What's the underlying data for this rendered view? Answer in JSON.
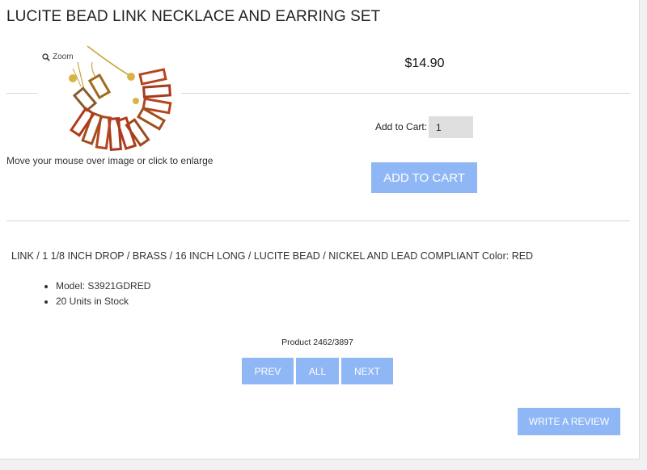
{
  "product": {
    "title": "LUCITE BEAD LINK NECKLACE AND EARRING SET",
    "price": "$14.90",
    "image_alt": "Lucite bead link necklace and earring set"
  },
  "image_area": {
    "zoom_label": "Zoom",
    "enlarge_hint": "Move your mouse over image or click to enlarge"
  },
  "cart": {
    "label": "Add to Cart:",
    "quantity": "1",
    "button_label": "ADD TO CART"
  },
  "details": {
    "description": "LINK / 1 1/8 INCH DROP / BRASS / 16 INCH LONG / LUCITE BEAD / NICKEL AND LEAD COMPLIANT Color: RED",
    "specs": [
      "Model: S3921GDRED",
      "20 Units in Stock"
    ]
  },
  "navigation": {
    "counter": "Product 2462/3897",
    "prev_label": "PREV",
    "all_label": "ALL",
    "next_label": "NEXT"
  },
  "review": {
    "button_label": "WRITE A REVIEW"
  },
  "colors": {
    "button_bg": "#8fb7f5",
    "input_bg": "#dedede",
    "divider": "#d6d6d6"
  }
}
